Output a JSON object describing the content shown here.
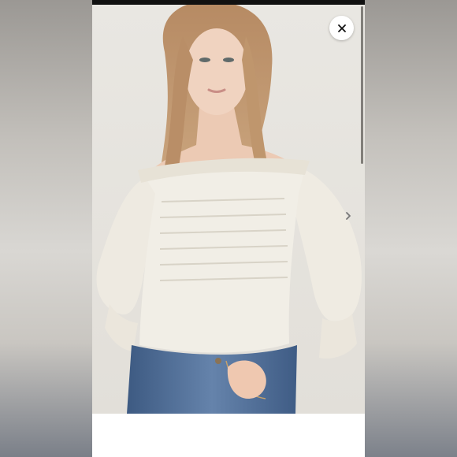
{
  "viewer": {
    "close_icon": "close-icon",
    "next_icon": "chevron-right-icon",
    "colors": {
      "backdrop": "#d6d3ce",
      "top_bar": "#111111",
      "photo_background": "#e8e6e1",
      "close_button_bg": "#ffffff",
      "below_photo": "#ffffff"
    }
  },
  "photo": {
    "subject": "model-photo",
    "top_color": "#efebe2",
    "jeans_color": "#4f6d95"
  }
}
